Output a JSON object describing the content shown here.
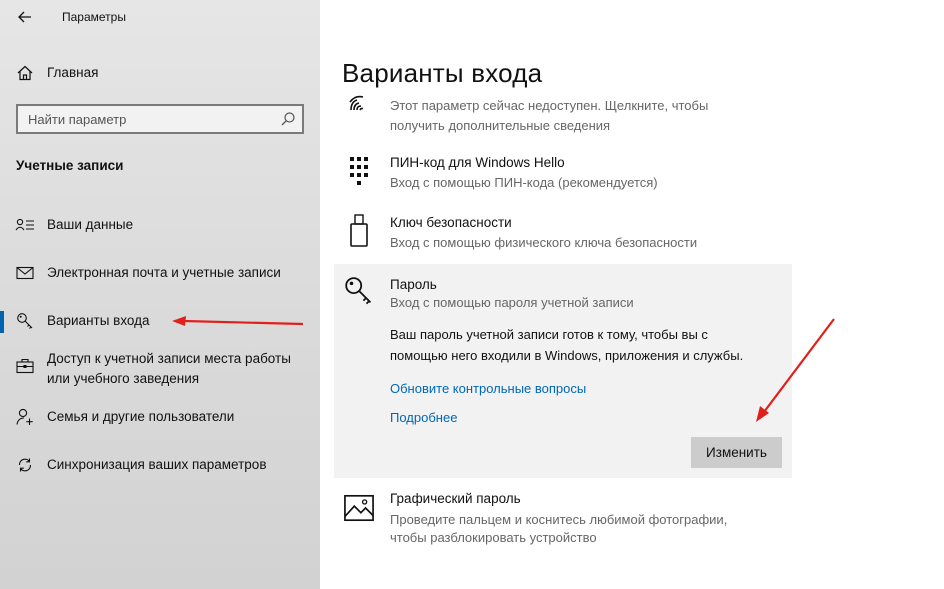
{
  "window": {
    "title": "Параметры"
  },
  "sidebar": {
    "home": {
      "label": "Главная",
      "icon": "home-icon"
    },
    "search": {
      "placeholder": "Найти параметр",
      "icon": "search-icon"
    },
    "section_title": "Учетные записи",
    "items": [
      {
        "label": "Ваши данные",
        "icon": "person-card-icon",
        "active": false
      },
      {
        "label": "Электронная почта и учетные записи",
        "icon": "mail-icon",
        "active": false
      },
      {
        "label": "Варианты входа",
        "icon": "key-icon",
        "active": true
      },
      {
        "label_line1": "Доступ к учетной записи места работы",
        "label_line2": "или учебного заведения",
        "icon": "briefcase-icon",
        "active": false
      },
      {
        "label": "Семья и другие пользователи",
        "icon": "person-add-icon",
        "active": false
      },
      {
        "label": "Синхронизация ваших параметров",
        "icon": "sync-icon",
        "active": false
      }
    ],
    "accent_color": "#0063b1"
  },
  "main": {
    "title": "Варианты входа",
    "options": [
      {
        "icon": "fingerprint-icon",
        "desc_line1": "Этот параметр сейчас недоступен. Щелкните, чтобы",
        "desc_line2": "получить дополнительные сведения"
      },
      {
        "icon": "pin-keypad-icon",
        "title": "ПИН-код для Windows Hello",
        "desc": "Вход с помощью ПИН-кода (рекомендуется)"
      },
      {
        "icon": "usb-key-icon",
        "title": "Ключ безопасности",
        "desc": "Вход с помощью физического ключа безопасности"
      },
      {
        "icon": "password-key-icon",
        "title": "Пароль",
        "desc": "Вход с помощью пароля учетной записи",
        "info_line1": "Ваш пароль учетной записи готов к тому, чтобы вы с",
        "info_line2": "помощью него входили в Windows, приложения и службы.",
        "link_questions": "Обновите контрольные вопросы",
        "link_more": "Подробнее",
        "button": "Изменить"
      },
      {
        "icon": "picture-icon",
        "title": "Графический пароль",
        "desc_line1": "Проведите пальцем и коснитесь любимой фотографии,",
        "desc_line2": "чтобы разблокировать устройство"
      }
    ],
    "link_color": "#0067b8",
    "annotation_color": "#e0201b"
  }
}
